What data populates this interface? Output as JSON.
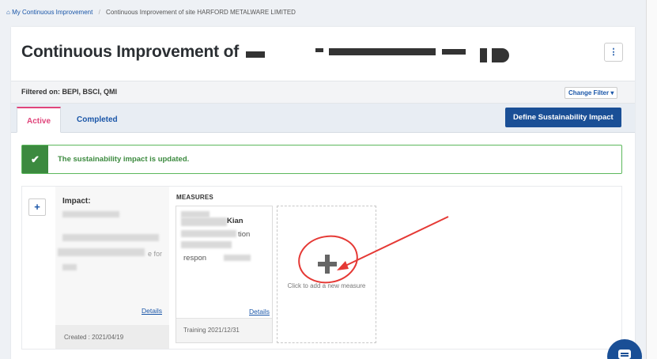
{
  "breadcrumb": {
    "home_icon": "home-icon",
    "home_glyph": "⌂",
    "home_label": "My Continuous Improvement",
    "separator": "/",
    "current": "Continuous Improvement of site HARFORD METALWARE LIMITED"
  },
  "header": {
    "title_prefix": "Continuous Improvement of",
    "menu_glyph": "⋮"
  },
  "filter": {
    "label": "Filtered on: BEPI, BSCI, QMI",
    "button_label": "Change Filter ▾"
  },
  "tabs": [
    {
      "label": "Active",
      "active": true
    },
    {
      "label": "Completed",
      "active": false
    }
  ],
  "define_button": "Define Sustainability Impact",
  "alert": {
    "glyph": "✔",
    "message": "The sustainability impact is updated."
  },
  "impact": {
    "add_glyph": "+",
    "title": "Impact:",
    "visible_fragment": "e for",
    "details_label": "Details",
    "created": "Created : 2021/04/19"
  },
  "measures": {
    "label": "MEASURES",
    "card": {
      "text_1": "Kian",
      "text_2": "tion",
      "text_3": "respon",
      "details_label": "Details",
      "footer": "Training 2021/12/31"
    },
    "add_card_text": "Click to add a new measure"
  },
  "colors": {
    "brand_blue": "#1a4f96",
    "active_tab_pink": "#e0457b",
    "success_green": "#3c8a3f",
    "annotation_red": "#e53935"
  }
}
